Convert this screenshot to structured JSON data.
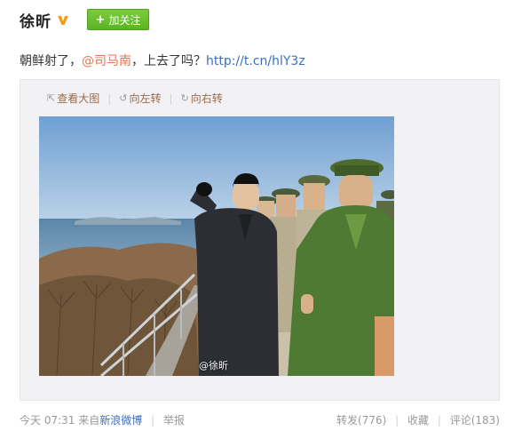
{
  "post": {
    "author": "徐昕",
    "follow_label": "加关注",
    "text_prefix": "朝鲜射了，",
    "mention": "@司马南",
    "text_suffix": "，上去了吗？",
    "link": "http://t.cn/hlY3z",
    "watermark": "@徐昕"
  },
  "media_tools": {
    "view_large": "查看大图",
    "rotate_left": "向左转",
    "rotate_right": "向右转"
  },
  "footer": {
    "time": "今天 07:31",
    "from_label": "来自",
    "source": "新浪微博",
    "report": "举报",
    "repost": "转发(776)",
    "favorite": "收藏",
    "comment": "评论(183)"
  },
  "colors": {
    "follow_green": "#5ab424",
    "accent_orange": "#eb7350",
    "link_blue": "#3a6fbf"
  }
}
